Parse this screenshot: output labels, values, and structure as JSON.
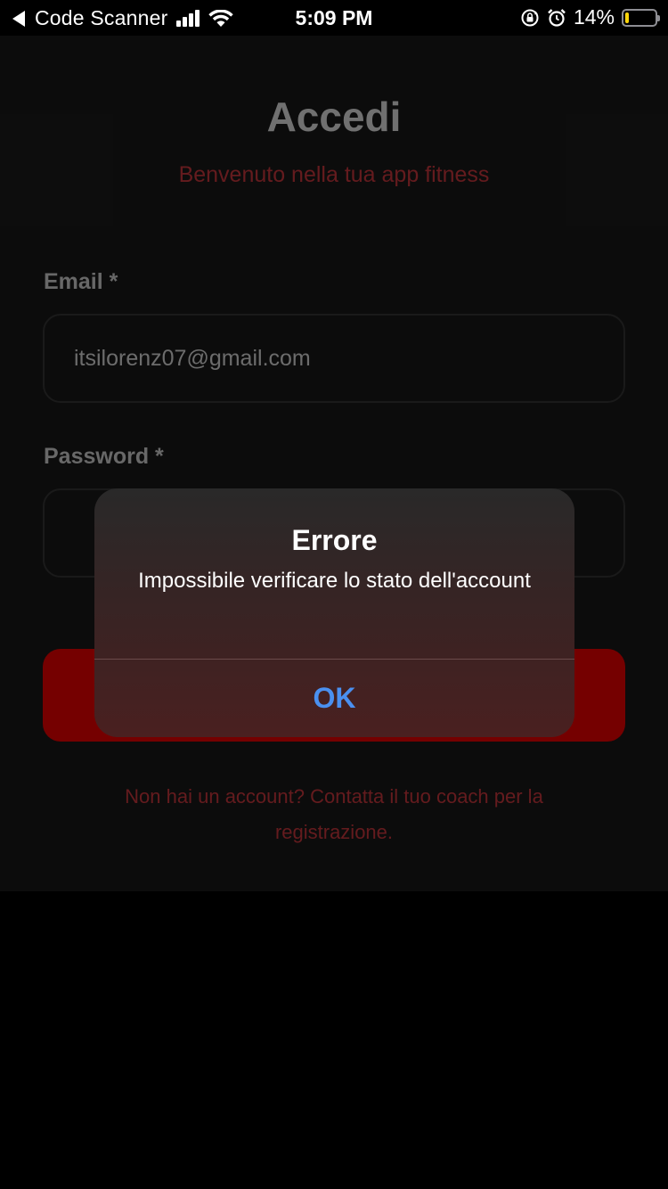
{
  "status_bar": {
    "back_app": "Code Scanner",
    "time": "5:09 PM",
    "battery_percent": "14%",
    "battery_level": 0.14,
    "battery_color": "#ffd60a",
    "icons": [
      "back-arrow-icon",
      "signal-icon",
      "wifi-icon",
      "rotation-lock-icon",
      "alarm-icon",
      "battery-icon"
    ]
  },
  "login": {
    "title": "Accedi",
    "subtitle": "Benvenuto nella tua app fitness",
    "email_label": "Email *",
    "email_value": "itsilorenz07@gmail.com",
    "password_label": "Password *",
    "password_value": "",
    "register_text": "Non hai un account? Contatta il tuo coach per la registrazione.",
    "accent_color": "#e00000"
  },
  "alert": {
    "title": "Errore",
    "message": "Impossibile verificare lo stato dell'account",
    "ok_label": "OK",
    "ok_color": "#4a90f0"
  }
}
